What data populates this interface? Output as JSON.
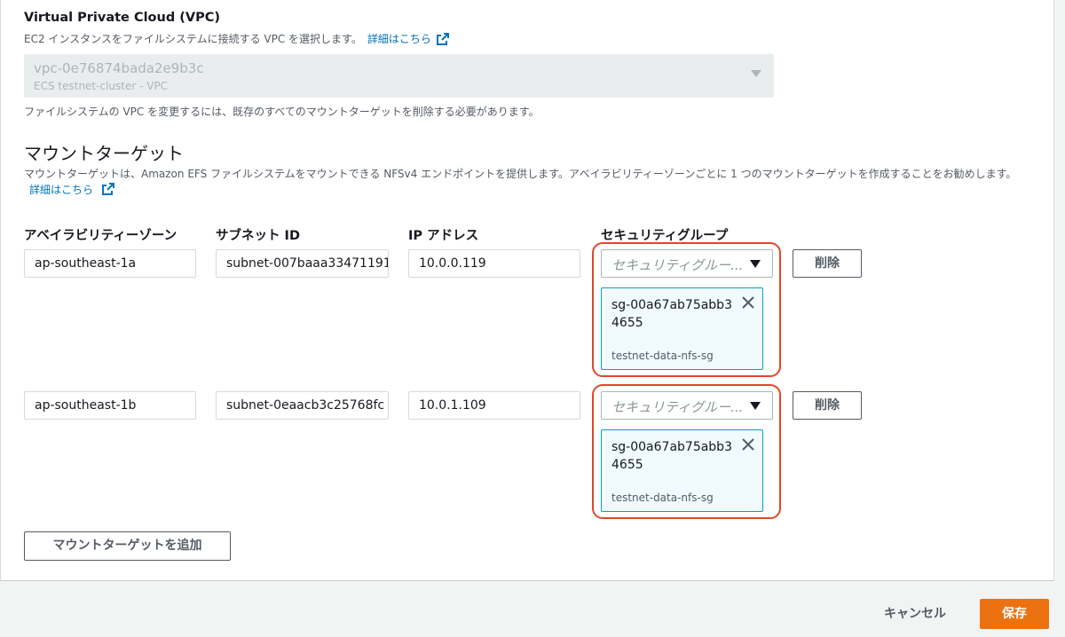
{
  "vpc": {
    "label": "Virtual Private Cloud (VPC)",
    "description": "EC2 インスタンスをファイルシステムに接続する VPC を選択します。",
    "link_text": "詳細はこちら",
    "selected_id": "vpc-0e76874bada2e9b3c",
    "selected_name": "ECS testnet-cluster - VPC",
    "note": "ファイルシステムの VPC を変更するには、既存のすべてのマウントターゲットを削除する必要があります。"
  },
  "mount_targets": {
    "title": "マウントターゲット",
    "description": "マウントターゲットは、Amazon EFS ファイルシステムをマウントできる NFSv4 エンドポイントを提供します。アベイラビリティーゾーンごとに 1 つのマウントターゲットを作成することをお勧めします。",
    "link_text": "詳細はこちら",
    "columns": {
      "az": "アベイラビリティーゾーン",
      "subnet": "サブネット ID",
      "ip": "IP アドレス",
      "sg": "セキュリティグループ"
    },
    "rows": [
      {
        "az": "ap-southeast-1a",
        "subnet": "subnet-007baaa33471191",
        "ip": "10.0.0.119",
        "sg_placeholder": "セキュリティグルー...",
        "sg_token_id": "sg-00a67ab75abb34655",
        "sg_token_name": "testnet-data-nfs-sg",
        "delete_label": "削除"
      },
      {
        "az": "ap-southeast-1b",
        "subnet": "subnet-0eaacb3c25768fc",
        "ip": "10.0.1.109",
        "sg_placeholder": "セキュリティグルー...",
        "sg_token_id": "sg-00a67ab75abb34655",
        "sg_token_name": "testnet-data-nfs-sg",
        "delete_label": "削除"
      }
    ],
    "add_label": "マウントターゲットを追加"
  },
  "footer": {
    "cancel_label": "キャンセル",
    "save_label": "保存"
  },
  "colors": {
    "link": "#0073bb",
    "primary": "#ec7211",
    "highlight": "#e0472b",
    "token_border": "#00a1c9"
  },
  "icons": {
    "external_link": "external-link-icon",
    "dropdown": "caret-down-icon",
    "remove": "close-icon"
  }
}
